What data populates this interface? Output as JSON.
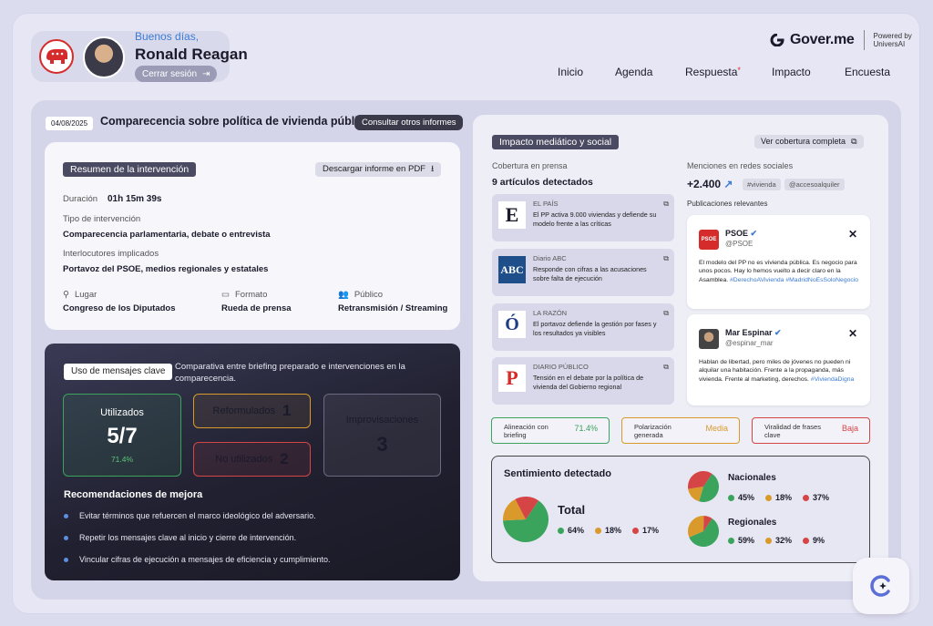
{
  "user": {
    "greeting": "Buenos días,",
    "name": "Ronald Reagan",
    "logout_label": "Cerrar sesión"
  },
  "brand": {
    "name": "Gover.me",
    "powered_line1": "Powered by",
    "powered_line2": "UniversAI"
  },
  "nav": {
    "items": [
      {
        "label": "Inicio"
      },
      {
        "label": "Agenda"
      },
      {
        "label": "Respuesta",
        "badge": "*"
      },
      {
        "label": "Impacto"
      },
      {
        "label": "Encuesta"
      }
    ]
  },
  "report": {
    "date": "04/08/2025",
    "title": "Comparecencia sobre política de vivienda pública",
    "other_reports_label": "Consultar otros informes"
  },
  "summary": {
    "tag": "Resumen de la intervención",
    "download_label": "Descargar informe en PDF",
    "duration_label": "Duración",
    "duration_value": "01h 15m 39s",
    "type_label": "Tipo de intervención",
    "type_value": "Comparecencia parlamentaria, debate o entrevista",
    "interlocutors_label": "Interlocutores implicados",
    "interlocutors_value": "Portavoz del PSOE, medios regionales y estatales",
    "place_label": "Lugar",
    "place_value": "Congreso de los Diputados",
    "format_label": "Formato",
    "format_value": "Rueda de prensa",
    "audience_label": "Público",
    "audience_value": "Retransmisión / Streaming"
  },
  "key_messages": {
    "tag": "Uso de mensajes clave",
    "description": "Comparativa entre briefing preparado e intervenciones en la comparecencia.",
    "used_label": "Utilizados",
    "used_value": "5/7",
    "used_pct": "71.4%",
    "reformulated_label": "Reformulados",
    "reformulated_value": "1",
    "unused_label": "No utilizados",
    "unused_value": "2",
    "improv_label": "Improvisaciones",
    "improv_value": "3",
    "recs_title": "Recomendaciones de mejora",
    "recs": [
      "Evitar términos que refuercen el marco ideológico del adversario.",
      "Repetir los mensajes clave al inicio y cierre de intervención.",
      "Vincular cifras de ejecución a mensajes de eficiencia y cumplimiento."
    ]
  },
  "media": {
    "tag": "Impacto mediático y social",
    "full_coverage_label": "Ver cobertura completa",
    "press_label": "Cobertura en prensa",
    "articles_count": "9 artículos detectados",
    "articles": [
      {
        "source": "EL PAÍS",
        "logo": "E",
        "headline": "El PP activa 9.000 viviendas y defiende su modelo frente a las críticas"
      },
      {
        "source": "Diario ABC",
        "logo": "ABC",
        "headline": "Responde con cifras a las acusaciones sobre falta de ejecución"
      },
      {
        "source": "LA RAZÓN",
        "logo": "Ó",
        "headline": "El portavoz defiende la gestión por fases y los resultados ya visibles"
      },
      {
        "source": "DIARIO PÚBLICO",
        "logo": "P",
        "headline": "Tensión en el debate por la política de vivienda del Gobierno regional"
      }
    ],
    "social_label": "Menciones en redes sociales",
    "mentions_value": "+2.400",
    "hashtags": [
      "#vivienda",
      "@accesoalquiler"
    ],
    "posts_label": "Publicaciones relevantes",
    "posts": [
      {
        "name": "PSOE",
        "handle": "@PSOE",
        "text": "El modelo del PP no es vivienda pública. Es negocio para unos pocos. Hay lo hemos vuelto a decir claro en la Asamblea.",
        "tags": "#DerechoAVivienda #MadridNoEsSoloNegocio",
        "avatar_text": "PSOE"
      },
      {
        "name": "Mar Espinar",
        "handle": "@espinar_mar",
        "text": "Hablan de libertad, pero miles de jóvenes no pueden ni alquilar una habitación. Frente a la propaganda, más vivienda. Frente al marketing, derechos.",
        "tags": "#ViviendaDigna",
        "avatar_text": ""
      }
    ]
  },
  "metrics": [
    {
      "label": "Alineación con briefing",
      "value": "71.4%",
      "color": "#3aa35c"
    },
    {
      "label": "Polarización generada",
      "value": "Media",
      "color": "#d99a2b"
    },
    {
      "label": "Viralidad de frases clave",
      "value": "Baja",
      "color": "#d64545"
    }
  ],
  "sentiment": {
    "title": "Sentimiento detectado",
    "total_label": "Total",
    "total": [
      "64%",
      "18%",
      "17%"
    ],
    "national_label": "Nacionales",
    "national": [
      "45%",
      "18%",
      "37%"
    ],
    "regional_label": "Regionales",
    "regional": [
      "59%",
      "32%",
      "9%"
    ],
    "colors": {
      "positive": "#3aa35c",
      "neutral": "#d99a2b",
      "negative": "#d64545"
    }
  },
  "colors": {
    "accent_blue": "#3a7bd5",
    "danger_red": "#d52b2b"
  }
}
